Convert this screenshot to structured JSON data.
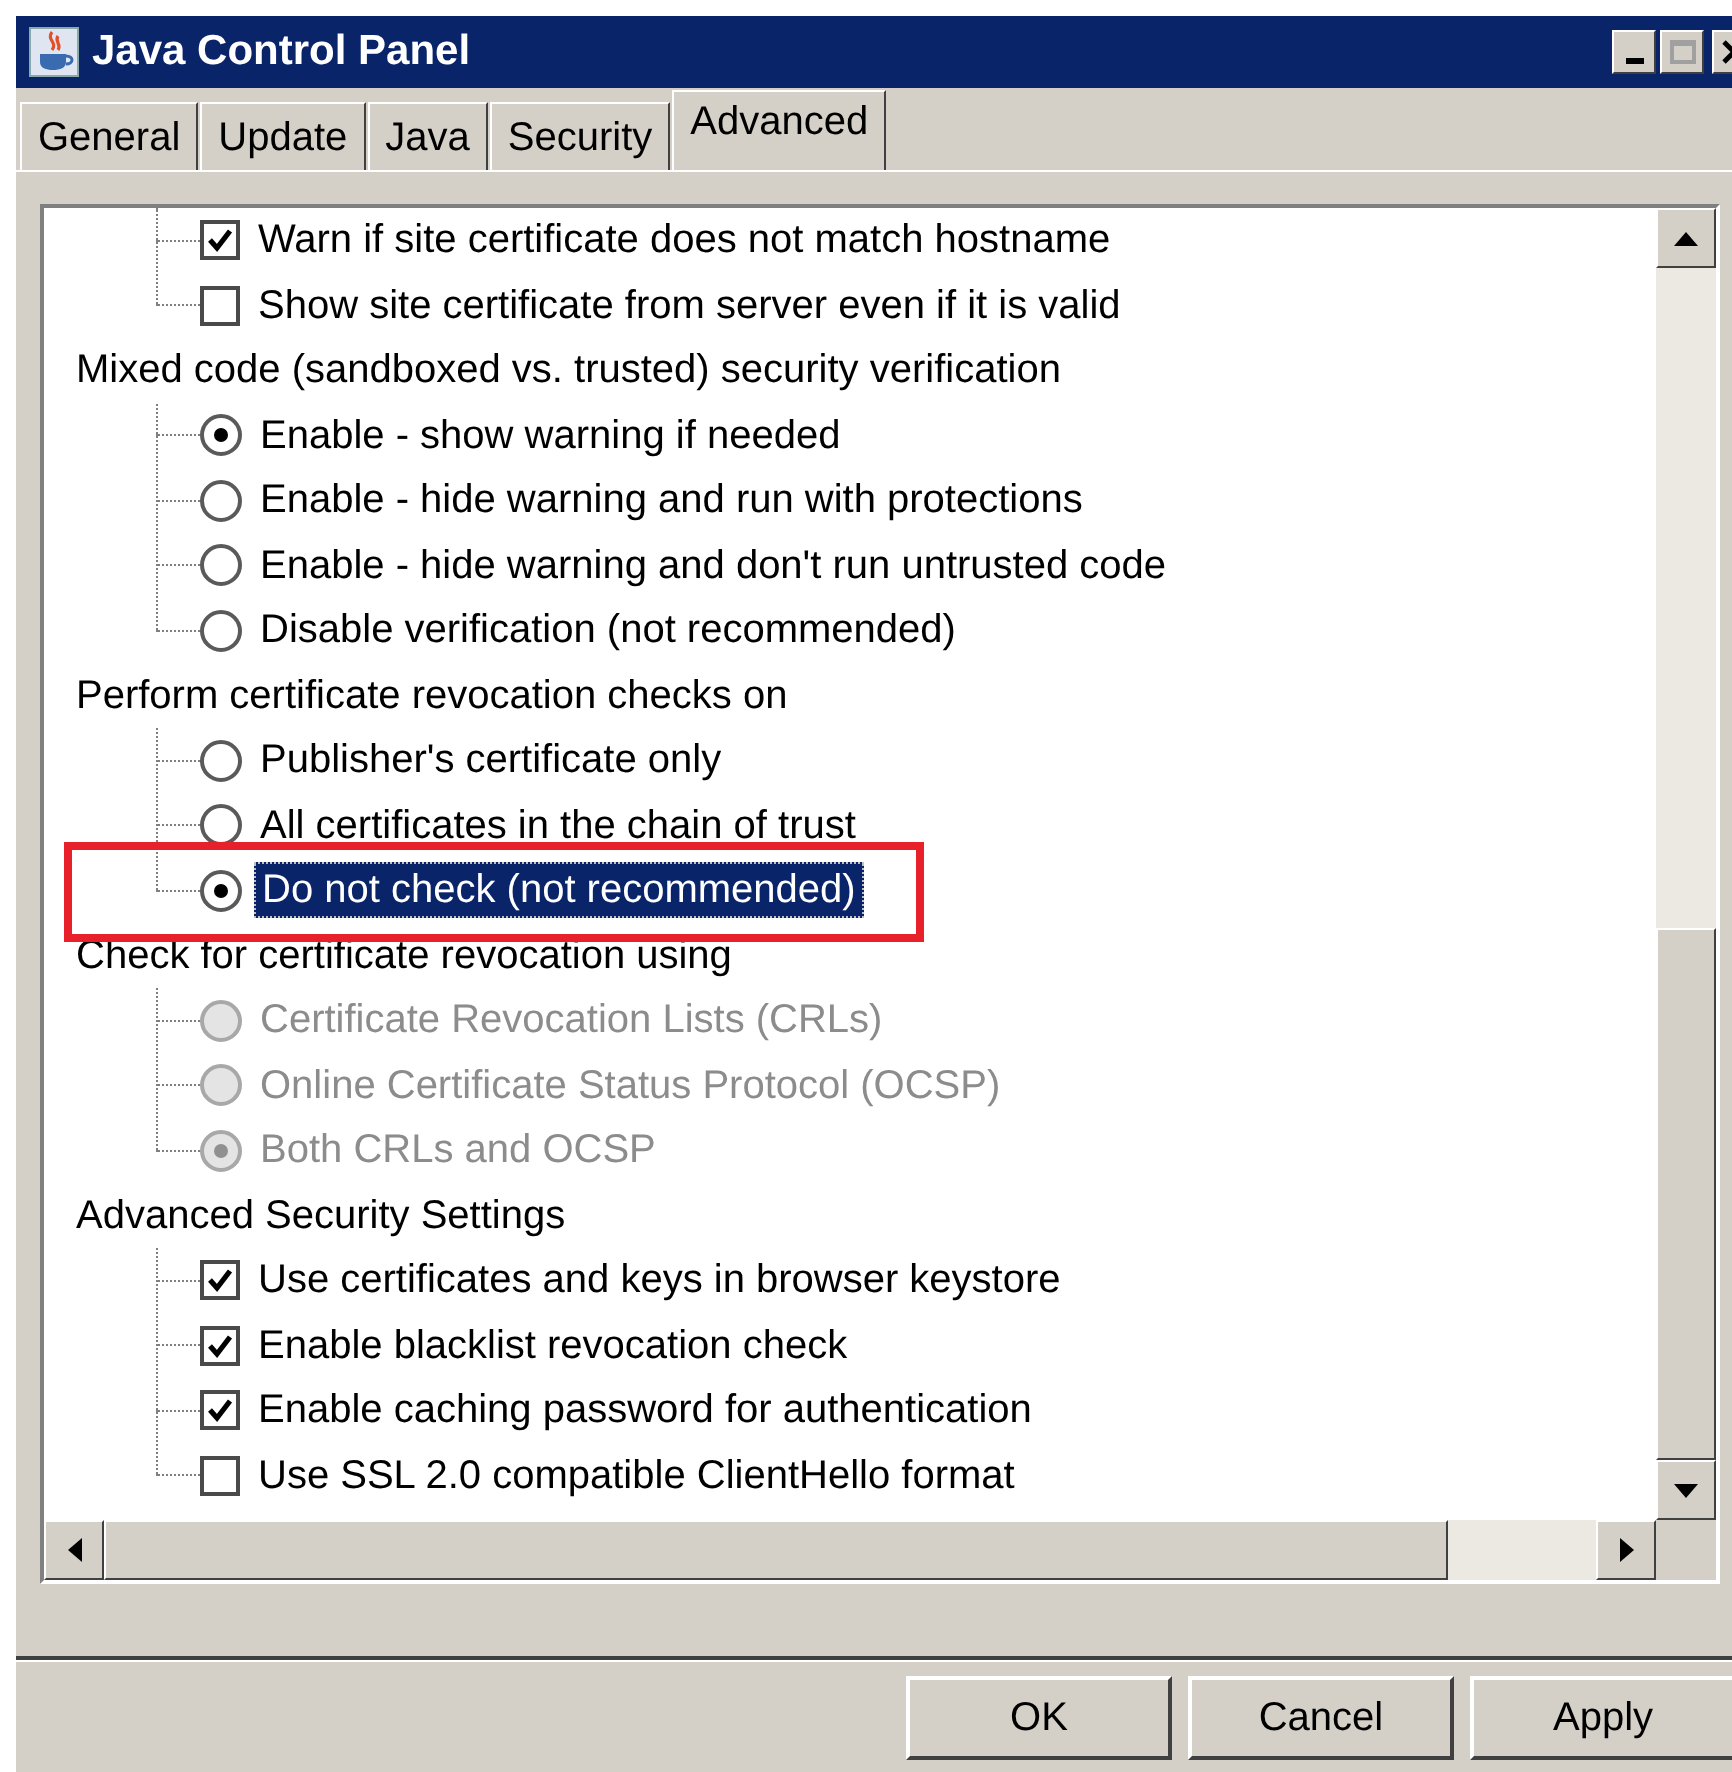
{
  "window": {
    "title": "Java Control Panel"
  },
  "tabs": [
    {
      "label": "General",
      "selected": false
    },
    {
      "label": "Update",
      "selected": false
    },
    {
      "label": "Java",
      "selected": false
    },
    {
      "label": "Security",
      "selected": false
    },
    {
      "label": "Advanced",
      "selected": true
    }
  ],
  "groups": [
    {
      "items": [
        {
          "kind": "checkbox",
          "label": "Warn if site certificate does not match hostname",
          "checked": true,
          "disabled": false,
          "selected": false
        },
        {
          "kind": "checkbox",
          "label": "Show site certificate from server even if it is valid",
          "checked": false,
          "disabled": false,
          "selected": false
        }
      ]
    },
    {
      "heading": "Mixed code (sandboxed vs. trusted) security verification",
      "items": [
        {
          "kind": "radio",
          "label": "Enable - show warning if needed",
          "checked": true,
          "disabled": false,
          "selected": false
        },
        {
          "kind": "radio",
          "label": "Enable - hide warning and run with protections",
          "checked": false,
          "disabled": false,
          "selected": false
        },
        {
          "kind": "radio",
          "label": "Enable - hide warning and don't run untrusted code",
          "checked": false,
          "disabled": false,
          "selected": false
        },
        {
          "kind": "radio",
          "label": "Disable verification (not recommended)",
          "checked": false,
          "disabled": false,
          "selected": false
        }
      ]
    },
    {
      "heading": "Perform certificate revocation checks on",
      "items": [
        {
          "kind": "radio",
          "label": "Publisher's certificate only",
          "checked": false,
          "disabled": false,
          "selected": false
        },
        {
          "kind": "radio",
          "label": "All certificates in the chain of trust",
          "checked": false,
          "disabled": false,
          "selected": false
        },
        {
          "kind": "radio",
          "label": "Do not check (not recommended)",
          "checked": true,
          "disabled": false,
          "selected": true
        }
      ]
    },
    {
      "heading": "Check for certificate revocation using",
      "items": [
        {
          "kind": "radio",
          "label": "Certificate Revocation Lists (CRLs)",
          "checked": false,
          "disabled": true,
          "selected": false
        },
        {
          "kind": "radio",
          "label": "Online Certificate Status Protocol (OCSP)",
          "checked": false,
          "disabled": true,
          "selected": false
        },
        {
          "kind": "radio",
          "label": "Both CRLs and OCSP",
          "checked": true,
          "disabled": true,
          "selected": false
        }
      ]
    },
    {
      "heading": "Advanced Security Settings",
      "items": [
        {
          "kind": "checkbox",
          "label": "Use certificates and keys in browser keystore",
          "checked": true,
          "disabled": false,
          "selected": false
        },
        {
          "kind": "checkbox",
          "label": "Enable blacklist revocation check",
          "checked": true,
          "disabled": false,
          "selected": false
        },
        {
          "kind": "checkbox",
          "label": "Enable caching password for authentication",
          "checked": true,
          "disabled": false,
          "selected": false
        },
        {
          "kind": "checkbox",
          "label": "Use SSL 2.0 compatible ClientHello format",
          "checked": false,
          "disabled": false,
          "selected": false
        }
      ]
    }
  ],
  "buttons": [
    "OK",
    "Cancel",
    "Apply"
  ]
}
